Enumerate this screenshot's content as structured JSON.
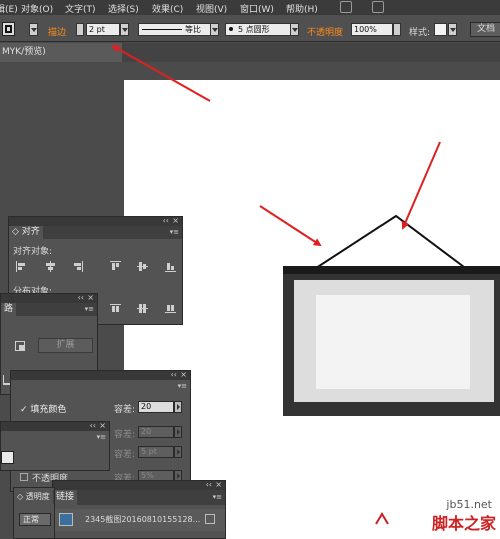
{
  "menubar": {
    "items": [
      "辑(E)",
      "对象(O)",
      "文字(T)",
      "选择(S)",
      "效果(C)",
      "视图(V)",
      "窗口(W)",
      "帮助(H)"
    ]
  },
  "controlbar": {
    "stroke_label": "描边",
    "stroke_weight": "2 pt",
    "profile_label": "等比",
    "brush_label": "5 点圆形",
    "opacity_label": "不透明度",
    "opacity_value": "100%",
    "style_label": "样式:",
    "doc_button": "文档"
  },
  "tabs": {
    "document_tab": "MYK/预览)"
  },
  "align_panel": {
    "tab": "对齐",
    "align_objects_label": "对齐对象:",
    "distribute_objects_label": "分布对象:"
  },
  "pathfinder_panel": {
    "tab": "路",
    "expand_button": "扩展"
  },
  "magic_wand_panel": {
    "fill_color_label": "填充颜色",
    "tolerance_label": "容差:",
    "fill_tolerance": "20",
    "stroke_tolerance": "20",
    "stroke_weight_tolerance": "5 pt",
    "opacity_label": "不透明度",
    "opacity_tolerance": "5%"
  },
  "transparency_panel": {
    "tab": "透明度",
    "blend_mode": "正常"
  },
  "links_panel": {
    "tab": "链接",
    "link_name": "2345截图20160810155128..."
  },
  "watermark": {
    "site": "jb51.net",
    "brand": "脚本之家"
  },
  "colors": {
    "arrow": "#e02020",
    "frame": "#333333",
    "mat": "#dddddd",
    "picture": "#f3f3f3",
    "accent_orange": "#ff8c1a"
  }
}
